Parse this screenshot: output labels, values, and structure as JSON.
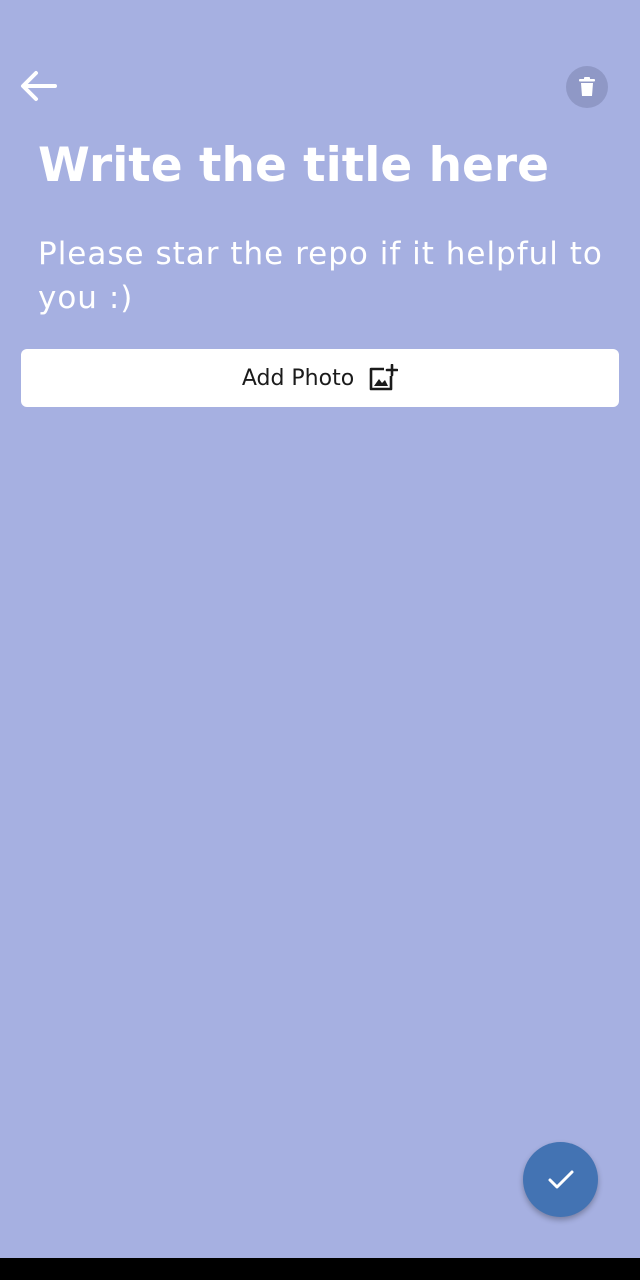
{
  "theme": {
    "background": "#a6b0e1",
    "fab_color": "#4373b3",
    "button_background": "#ffffff",
    "text_color": "#ffffff"
  },
  "toolbar": {
    "back_icon": "arrow-left-icon",
    "delete_icon": "trash-icon"
  },
  "note": {
    "title": "Write the title here",
    "body": "Please star the repo if it helpful to you :)"
  },
  "add_photo": {
    "label": "Add Photo",
    "icon": "add-photo-icon"
  },
  "fab": {
    "icon": "check-icon"
  }
}
